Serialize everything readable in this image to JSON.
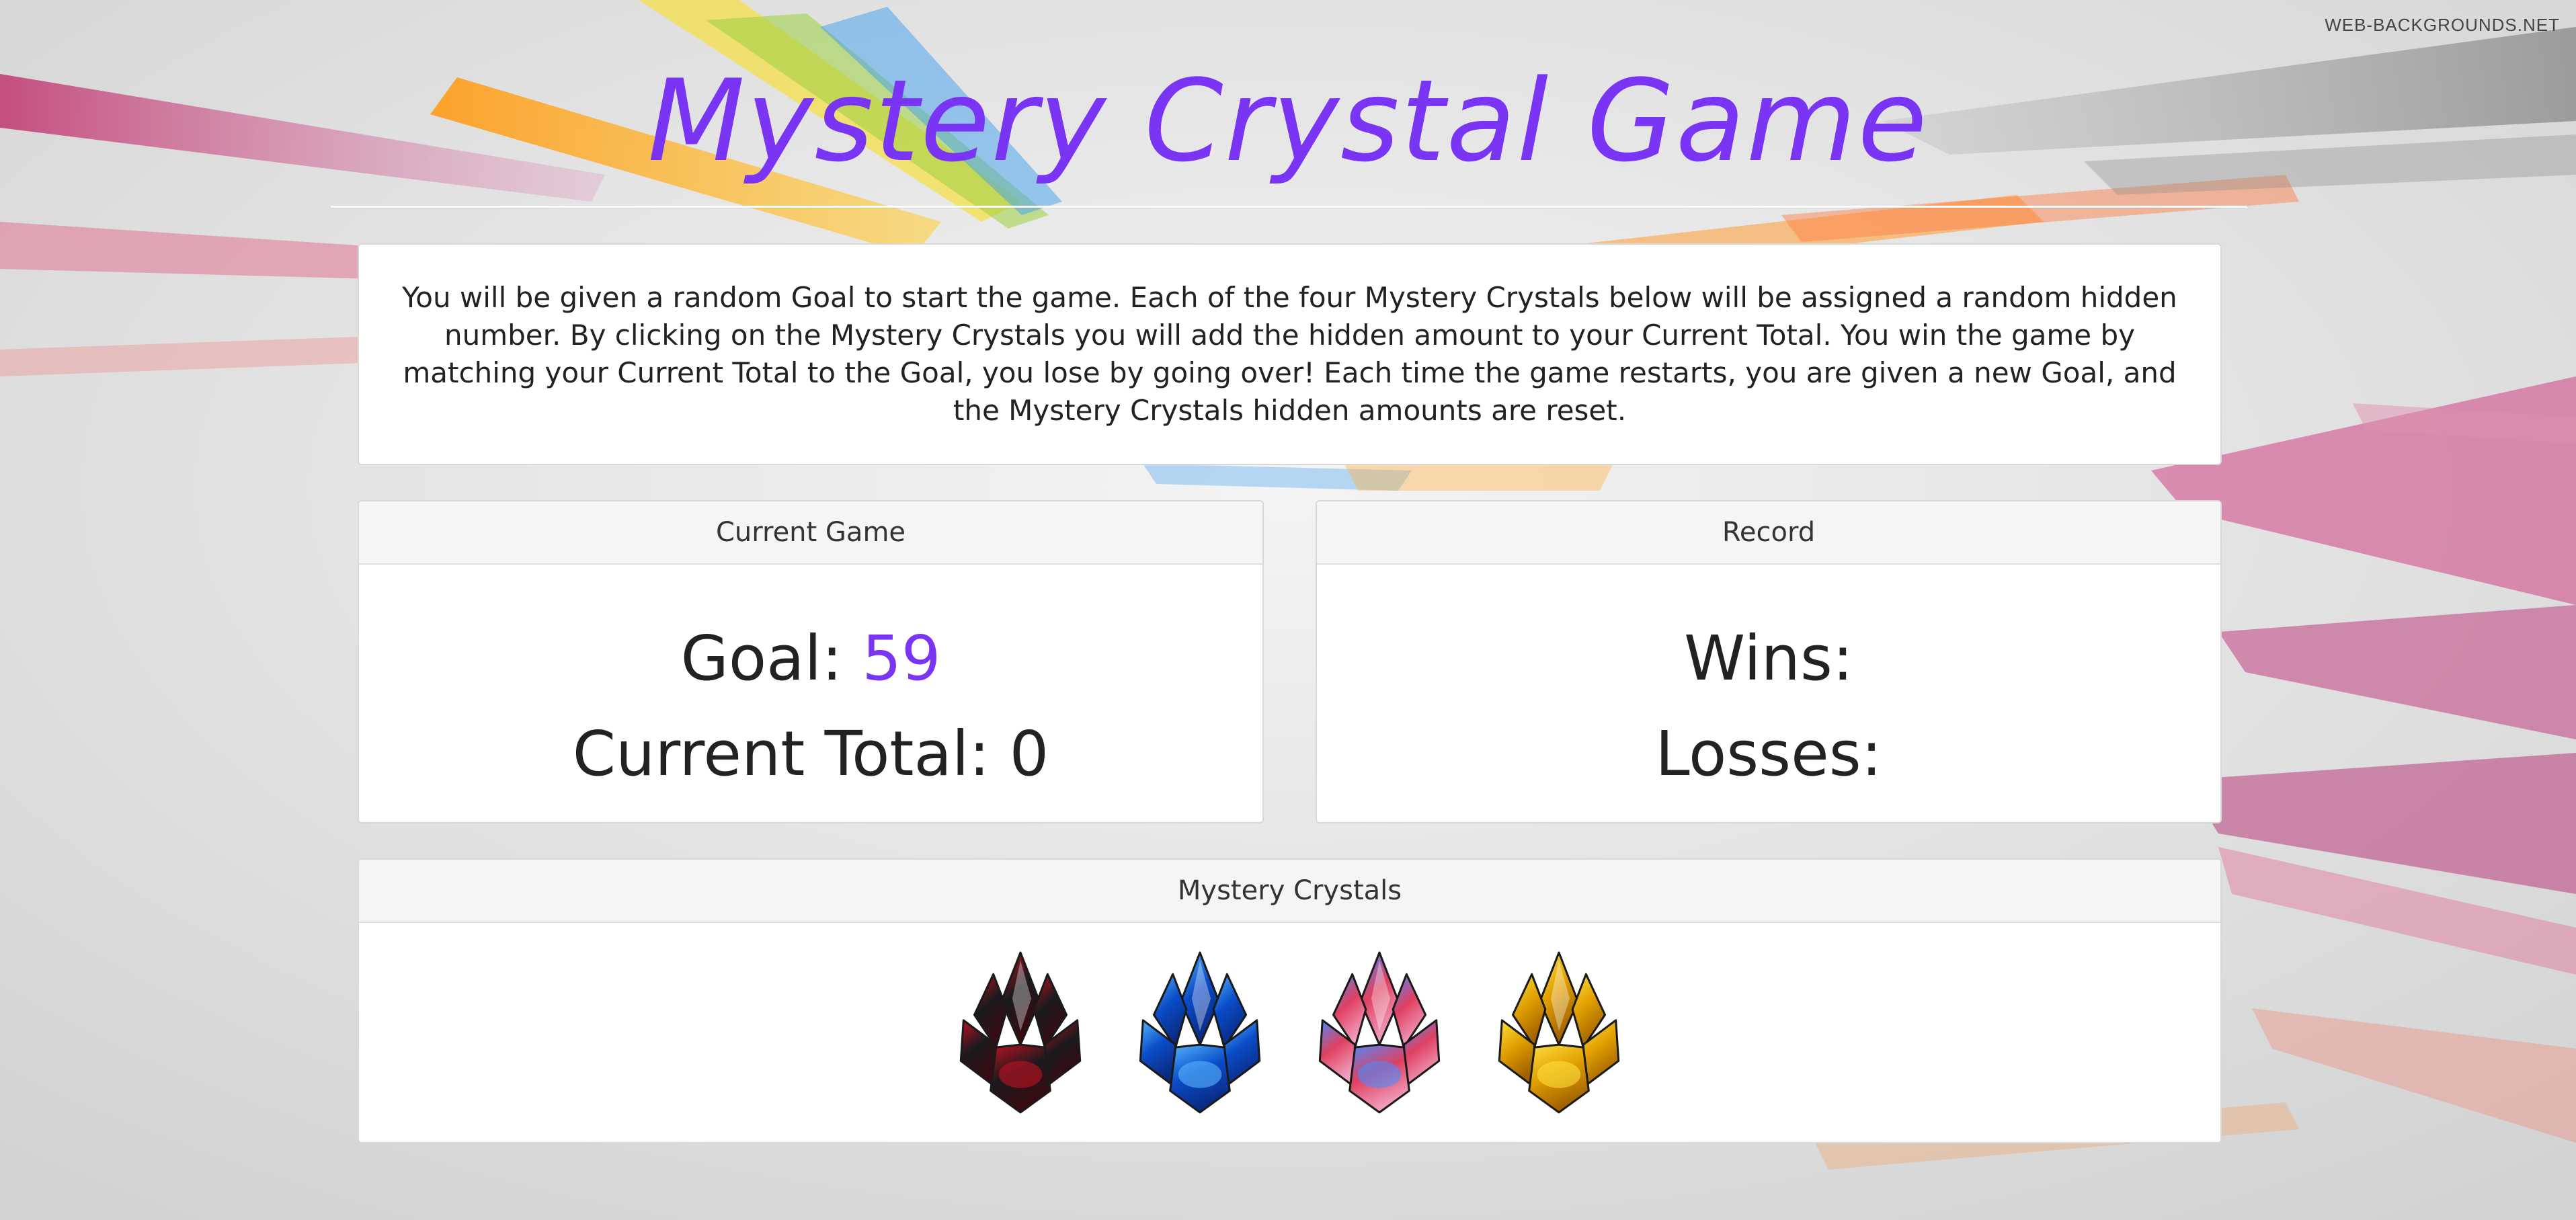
{
  "watermark": "WEB-BACKGROUNDS.NET",
  "title": "Mystery Crystal Game",
  "instructions": "You will be given a random Goal to start the game. Each of the four Mystery Crystals below will be assigned a random hidden number. By clicking on the Mystery Crystals you will add the hidden amount to your Current Total. You win the game by matching your Current Total to the Goal, you lose by going over! Each time the game restarts, you are given a new Goal, and the Mystery Crystals hidden amounts are reset.",
  "current_game": {
    "heading": "Current Game",
    "goal_label": "Goal: ",
    "goal_value": "59",
    "total_label": "Current Total: ",
    "total_value": "0"
  },
  "record": {
    "heading": "Record",
    "wins_label": "Wins:",
    "losses_label": "Losses:"
  },
  "crystals": {
    "heading": "Mystery Crystals",
    "items": [
      {
        "name": "red-black-crystal",
        "colors": [
          "#1a1a1e",
          "#c41020",
          "#3a0a10"
        ]
      },
      {
        "name": "blue-crystal",
        "colors": [
          "#0a4cc8",
          "#58b8ff",
          "#0a2a80"
        ]
      },
      {
        "name": "pink-blue-crystal",
        "colors": [
          "#e04060",
          "#4a8cff",
          "#f0a0c0"
        ]
      },
      {
        "name": "yellow-crystal",
        "colors": [
          "#e0a000",
          "#ffe040",
          "#a06000"
        ]
      }
    ]
  },
  "colors": {
    "accent": "#7a34f4",
    "panel_heading_bg": "#f5f5f5",
    "panel_bg": "#ffffff"
  }
}
